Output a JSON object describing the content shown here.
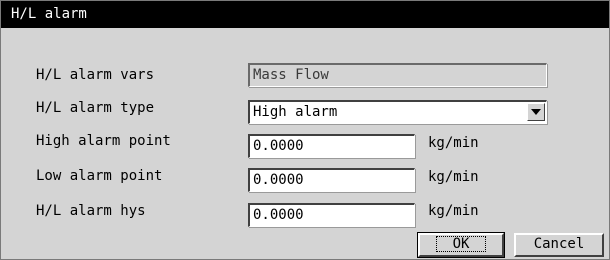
{
  "window": {
    "title": "H/L alarm"
  },
  "form": {
    "vars": {
      "label": "H/L alarm vars",
      "value": "Mass Flow"
    },
    "type": {
      "label": "H/L alarm type",
      "value": "High alarm"
    },
    "high": {
      "label": "High alarm point",
      "value": "0.0000",
      "unit": "kg/min"
    },
    "low": {
      "label": "Low alarm point",
      "value": "0.0000",
      "unit": "kg/min"
    },
    "hys": {
      "label": "H/L alarm hys",
      "value": "0.0000",
      "unit": "kg/min"
    }
  },
  "buttons": {
    "ok": "OK",
    "cancel": "Cancel"
  },
  "icons": {
    "dropdown": "chevron-down-icon"
  },
  "colors": {
    "titlebar": "#000000",
    "dialog_bg": "#d4d4d4",
    "field_bg": "#ffffff"
  }
}
